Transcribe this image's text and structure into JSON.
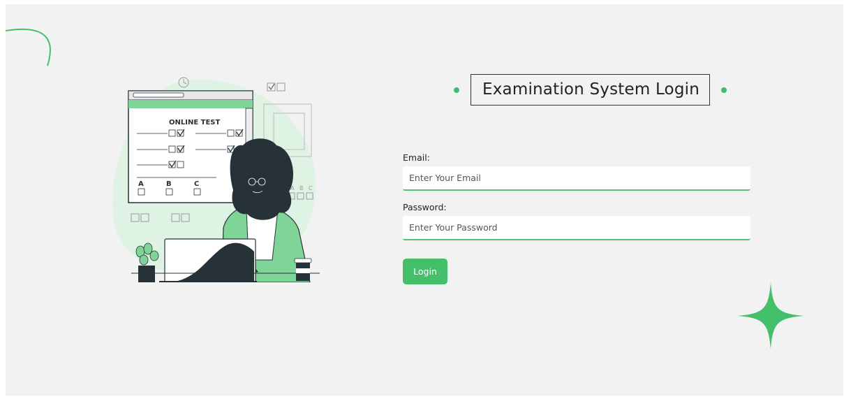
{
  "header": {
    "title": "Examination System Login"
  },
  "form": {
    "email_label": "Email:",
    "email_placeholder": "Enter Your Email",
    "email_value": "",
    "password_label": "Password:",
    "password_placeholder": "Enter Your Password",
    "password_value": "",
    "login_label": "Login"
  },
  "illustration": {
    "sheet_title": "ONLINE TEST",
    "choices": [
      "A",
      "B",
      "C"
    ]
  },
  "colors": {
    "accent": "#43c069",
    "background": "#f2f2f2",
    "blob": "#dff3e4"
  }
}
